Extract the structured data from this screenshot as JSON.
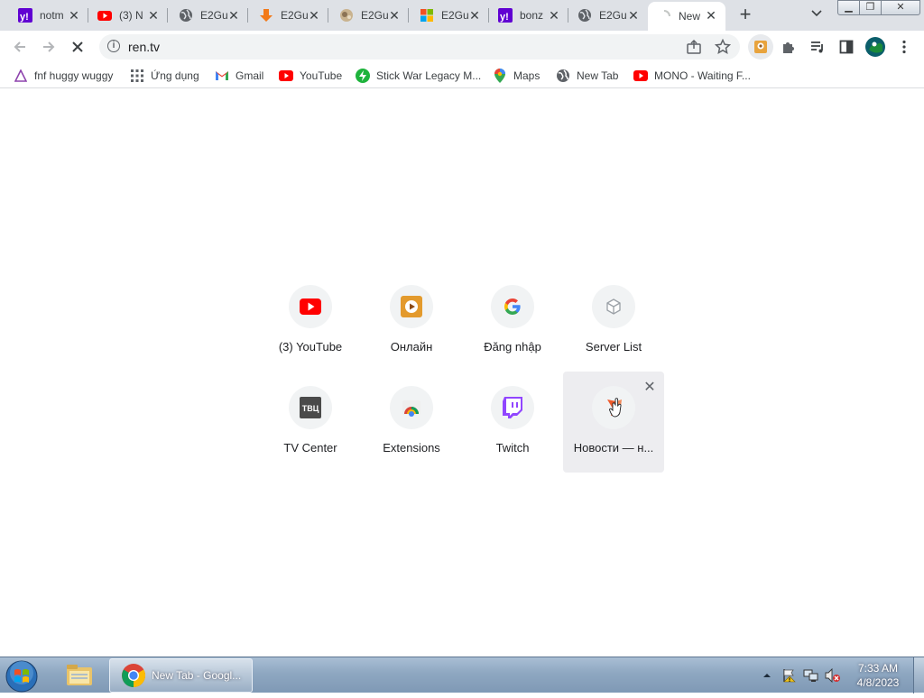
{
  "tabs": [
    {
      "title": "notm",
      "icon": "yahoo-icon"
    },
    {
      "title": "(3) N",
      "icon": "youtube-icon"
    },
    {
      "title": "E2Gu",
      "icon": "globe-icon"
    },
    {
      "title": "E2Gu",
      "icon": "download-arrow-icon"
    },
    {
      "title": "E2Gu",
      "icon": "image-thumb-icon"
    },
    {
      "title": "E2Gu",
      "icon": "microsoft-icon"
    },
    {
      "title": "bonz",
      "icon": "yahoo-icon"
    },
    {
      "title": "E2Gu",
      "icon": "globe-icon"
    },
    {
      "title": "New",
      "icon": "loading-spinner-icon",
      "active": true
    }
  ],
  "toolbar": {
    "url": "ren.tv"
  },
  "bookmarks": [
    {
      "label": "fnf huggy wuggy",
      "icon": "triangle-icon"
    },
    {
      "label": "Ứng dụng",
      "icon": "apps-grid-icon"
    },
    {
      "label": "Gmail",
      "icon": "gmail-icon"
    },
    {
      "label": "YouTube",
      "icon": "youtube-icon"
    },
    {
      "label": "Stick War Legacy M...",
      "icon": "bolt-icon"
    },
    {
      "label": "Maps",
      "icon": "maps-pin-icon"
    },
    {
      "label": "New Tab",
      "icon": "globe-icon"
    },
    {
      "label": "MONO - Waiting F...",
      "icon": "youtube-icon"
    }
  ],
  "shortcuts": [
    {
      "label": "(3) YouTube",
      "icon": "youtube-icon"
    },
    {
      "label": "Онлайн",
      "icon": "play-tile-icon"
    },
    {
      "label": "Đăng nhập",
      "icon": "google-g-icon"
    },
    {
      "label": "Server List",
      "icon": "cube-icon"
    },
    {
      "label": "TV Center",
      "icon": "tvc-logo-icon"
    },
    {
      "label": "Extensions",
      "icon": "chrome-webstore-icon"
    },
    {
      "label": "Twitch",
      "icon": "twitch-icon"
    },
    {
      "label": "Новости — н...",
      "icon": "ren-tv-icon",
      "hovered": true
    }
  ],
  "taskbar": {
    "chrome_label": "New Tab - Googl...",
    "time": "7:33 AM",
    "date": "4/8/2023"
  },
  "colors": {
    "tabstrip": "#dee1e6",
    "youtube_red": "#ff0000",
    "twitch_purple": "#9146ff",
    "yahoo_purple": "#6001d2"
  }
}
